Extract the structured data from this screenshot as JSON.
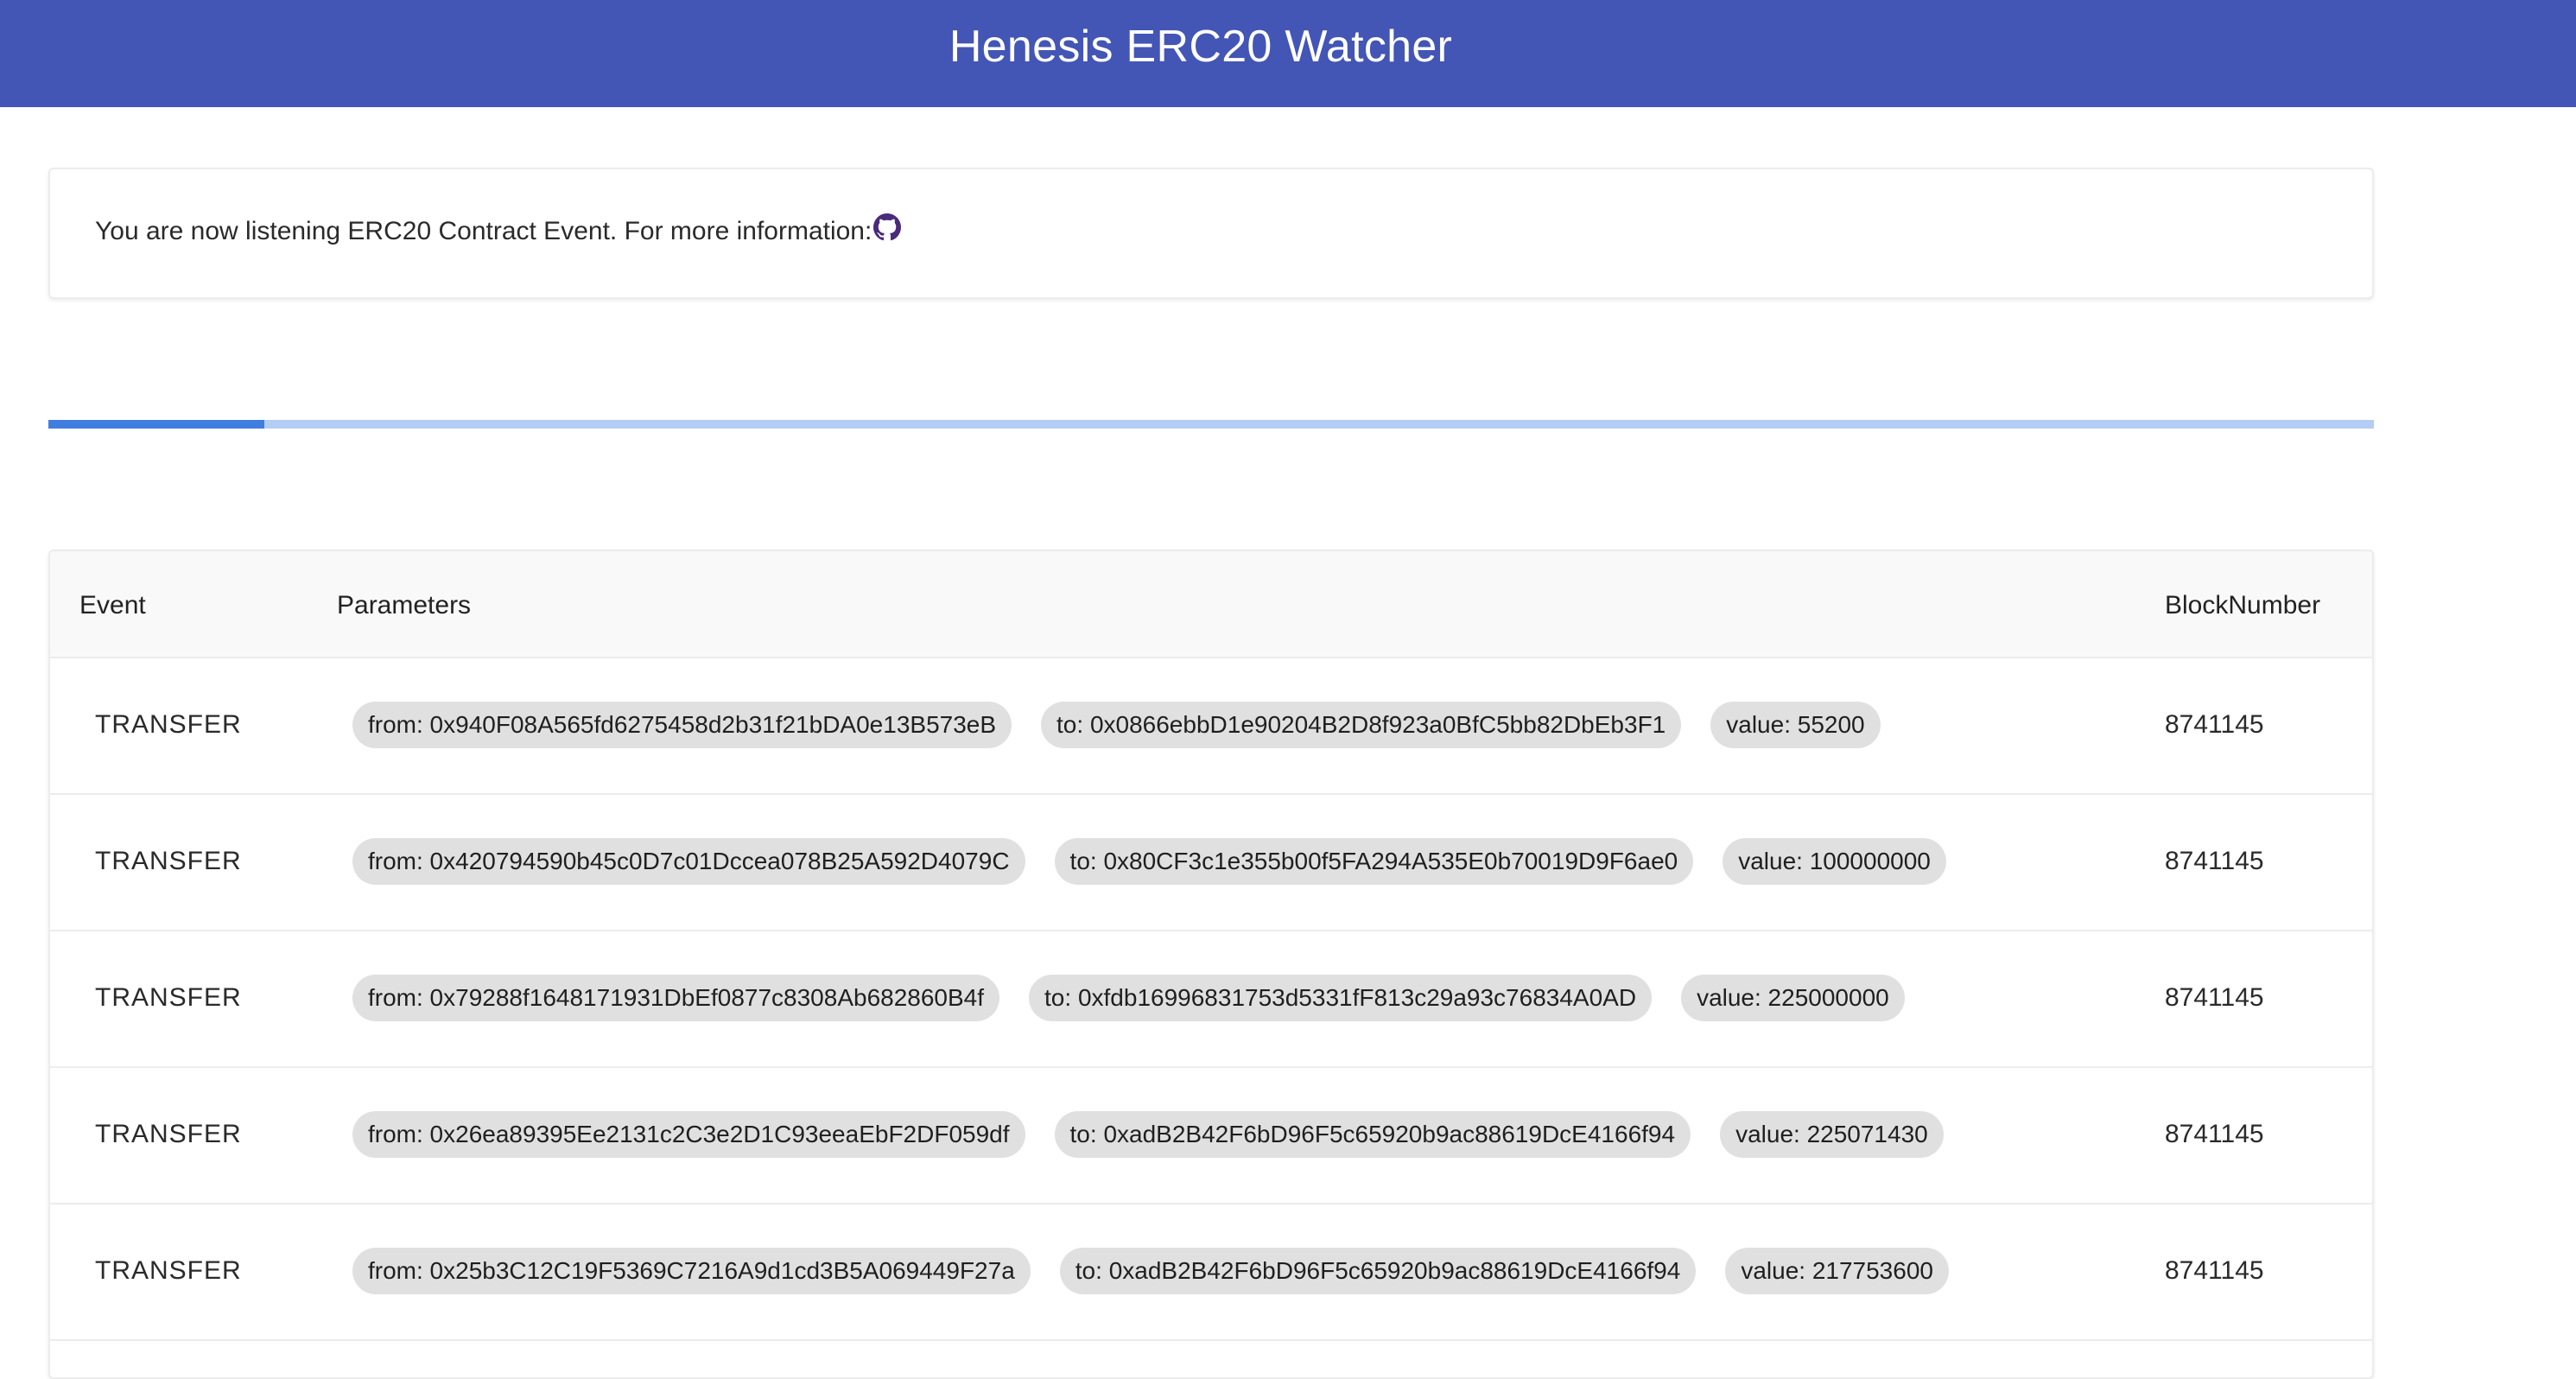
{
  "app": {
    "title": "Henesis ERC20 Watcher"
  },
  "info": {
    "text": "You are now listening ERC20 Contract Event. For more information:",
    "link_icon": "github-icon"
  },
  "progress": {
    "value_fraction": 0.093
  },
  "table": {
    "headers": {
      "event": "Event",
      "parameters": "Parameters",
      "block": "BlockNumber"
    },
    "rows": [
      {
        "event": "TRANSFER",
        "from": "from: 0x940F08A565fd6275458d2b31f21bDA0e13B573eB",
        "to": "to: 0x0866ebbD1e90204B2D8f923a0BfC5bb82DbEb3F1",
        "value": "value: 55200",
        "block": "8741145"
      },
      {
        "event": "TRANSFER",
        "from": "from: 0x420794590b45c0D7c01Dccea078B25A592D4079C",
        "to": "to: 0x80CF3c1e355b00f5FA294A535E0b70019D9F6ae0",
        "value": "value: 100000000",
        "block": "8741145"
      },
      {
        "event": "TRANSFER",
        "from": "from: 0x79288f1648171931DbEf0877c8308Ab682860B4f",
        "to": "to: 0xfdb16996831753d5331fF813c29a93c76834A0AD",
        "value": "value: 225000000",
        "block": "8741145"
      },
      {
        "event": "TRANSFER",
        "from": "from: 0x26ea89395Ee2131c2C3e2D1C93eeaEbF2DF059df",
        "to": "to: 0xadB2B42F6bD96F5c65920b9ac88619DcE4166f94",
        "value": "value: 225071430",
        "block": "8741145"
      },
      {
        "event": "TRANSFER",
        "from": "from: 0x25b3C12C19F5369C7216A9d1cd3B5A069449F27a",
        "to": "to: 0xadB2B42F6bD96F5c65920b9ac88619DcE4166f94",
        "value": "value: 217753600",
        "block": "8741145"
      }
    ]
  },
  "colors": {
    "appbar": "#4355b5",
    "progress_fill": "#3f7ee0",
    "progress_track": "#b3cdf5",
    "chip": "#e0e0e0"
  }
}
